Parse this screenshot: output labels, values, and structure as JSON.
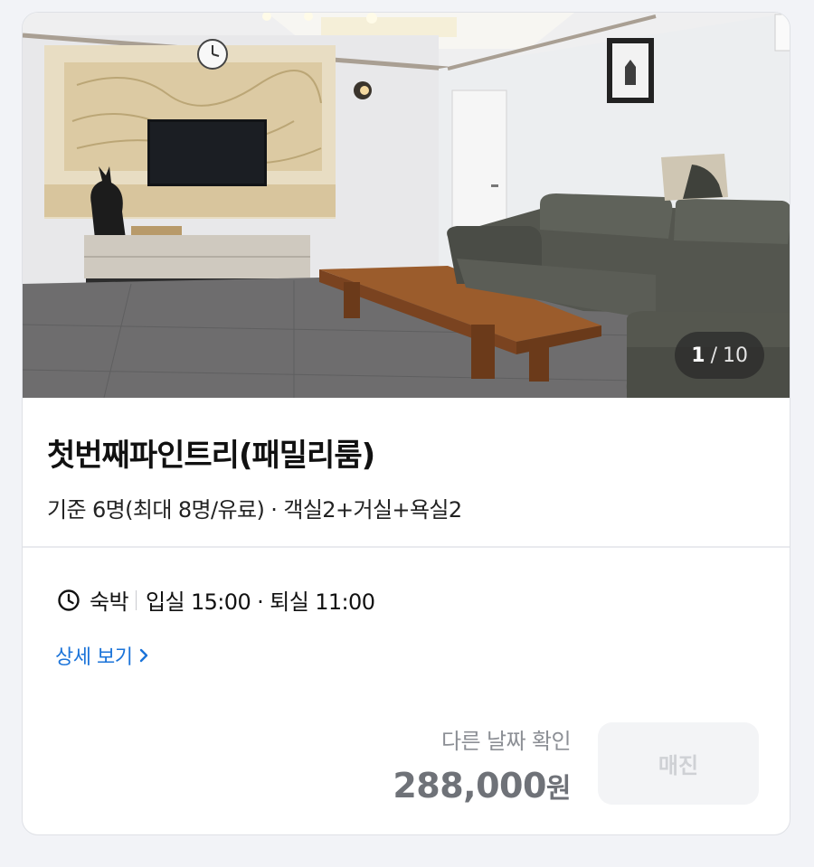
{
  "photo": {
    "counter_current": "1",
    "counter_separator": "/",
    "counter_total": "10"
  },
  "room": {
    "title": "첫번째파인트리(패밀리룸)",
    "description": "기준 6명(최대 8명/유료) · 객실2+거실+욕실2"
  },
  "stay": {
    "icon": "clock-icon",
    "type": "숙박",
    "times": "입실 15:00 · 퇴실 11:00"
  },
  "detail": {
    "label": "상세 보기",
    "icon": "chevron-right-icon",
    "color": "#1a73d9"
  },
  "price": {
    "other_date_label": "다른 날짜 확인",
    "amount": "288,000",
    "unit": "원"
  },
  "action": {
    "label": "매진"
  }
}
